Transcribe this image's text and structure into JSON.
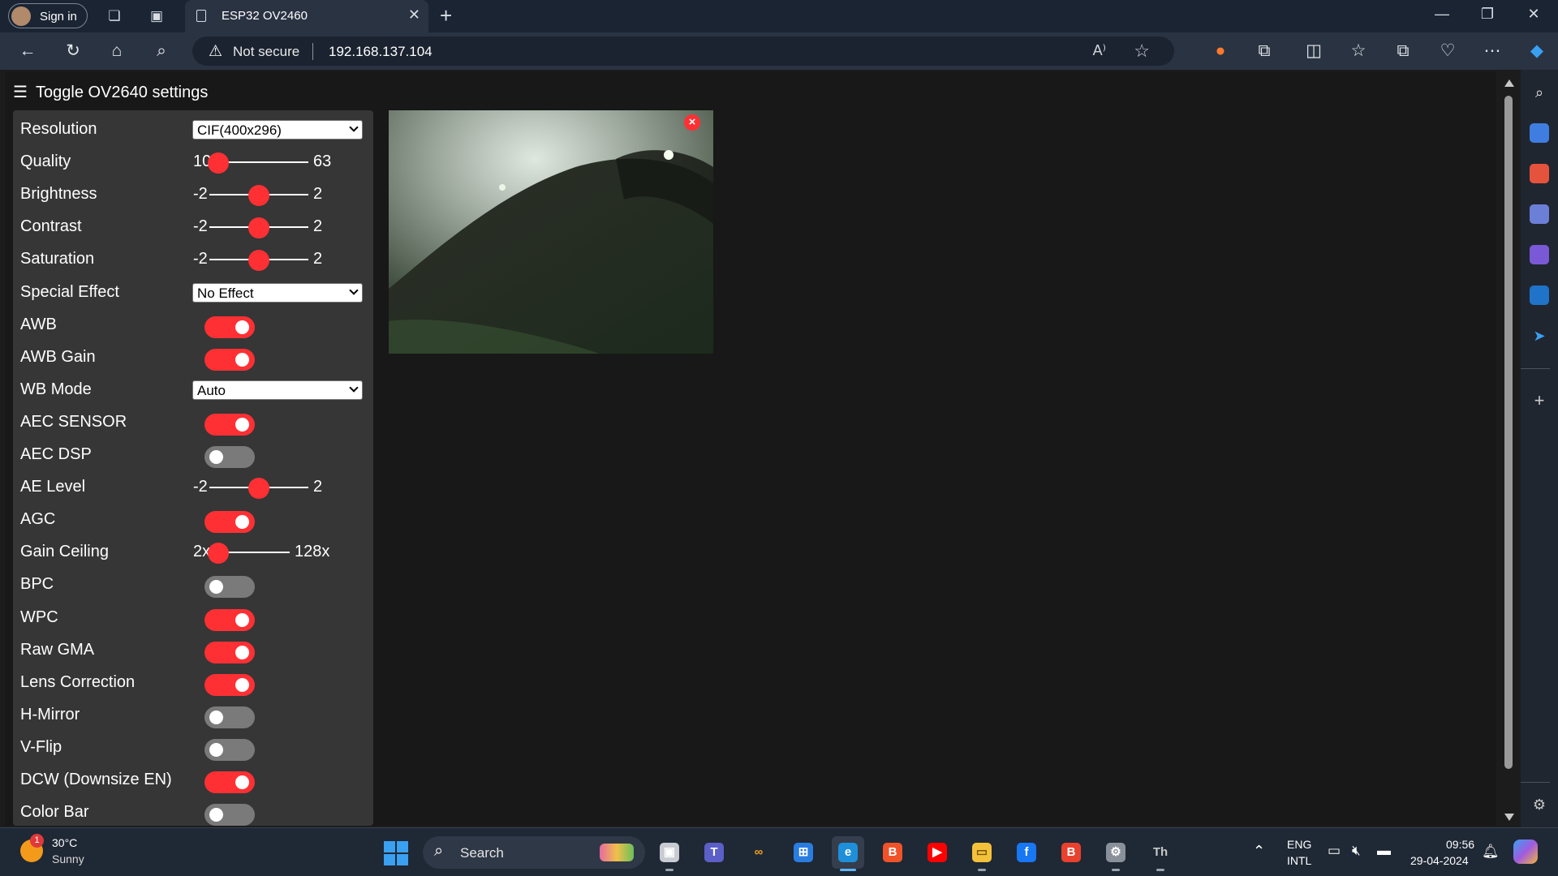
{
  "browser": {
    "signin_label": "Sign in",
    "tab_title": "ESP32 OV2460",
    "security_label": "Not secure",
    "url": "192.168.137.104"
  },
  "page": {
    "toggle_label": "Toggle OV2640 settings",
    "accent_color": "#ff3034",
    "settings": [
      {
        "key": "resolution",
        "label": "Resolution",
        "type": "select",
        "value": "CIF(400x296)"
      },
      {
        "key": "quality",
        "label": "Quality",
        "type": "range",
        "min": "10",
        "max": "63",
        "value_fraction": 0.0
      },
      {
        "key": "brightness",
        "label": "Brightness",
        "type": "range",
        "min": "-2",
        "max": "2",
        "value_fraction": 0.5
      },
      {
        "key": "contrast",
        "label": "Contrast",
        "type": "range",
        "min": "-2",
        "max": "2",
        "value_fraction": 0.5
      },
      {
        "key": "saturation",
        "label": "Saturation",
        "type": "range",
        "min": "-2",
        "max": "2",
        "value_fraction": 0.5
      },
      {
        "key": "special_effect",
        "label": "Special Effect",
        "type": "select",
        "value": "No Effect"
      },
      {
        "key": "awb",
        "label": "AWB",
        "type": "toggle",
        "on": true
      },
      {
        "key": "awb_gain",
        "label": "AWB Gain",
        "type": "toggle",
        "on": true
      },
      {
        "key": "wb_mode",
        "label": "WB Mode",
        "type": "select",
        "value": "Auto"
      },
      {
        "key": "aec_sensor",
        "label": "AEC SENSOR",
        "type": "toggle",
        "on": true
      },
      {
        "key": "aec_dsp",
        "label": "AEC DSP",
        "type": "toggle",
        "on": false
      },
      {
        "key": "ae_level",
        "label": "AE Level",
        "type": "range",
        "min": "-2",
        "max": "2",
        "value_fraction": 0.5
      },
      {
        "key": "agc",
        "label": "AGC",
        "type": "toggle",
        "on": true
      },
      {
        "key": "gain_ceiling",
        "label": "Gain Ceiling",
        "type": "range",
        "min": "2x",
        "max": "128x",
        "value_fraction": 0.0
      },
      {
        "key": "bpc",
        "label": "BPC",
        "type": "toggle",
        "on": false
      },
      {
        "key": "wpc",
        "label": "WPC",
        "type": "toggle",
        "on": true
      },
      {
        "key": "raw_gma",
        "label": "Raw GMA",
        "type": "toggle",
        "on": true
      },
      {
        "key": "lens_correction",
        "label": "Lens Correction",
        "type": "toggle",
        "on": true
      },
      {
        "key": "h_mirror",
        "label": "H-Mirror",
        "type": "toggle",
        "on": false
      },
      {
        "key": "v_flip",
        "label": "V-Flip",
        "type": "toggle",
        "on": false
      },
      {
        "key": "dcw",
        "label": "DCW (Downsize EN)",
        "type": "toggle",
        "on": true
      },
      {
        "key": "color_bar",
        "label": "Color Bar",
        "type": "toggle",
        "on": false
      }
    ],
    "stream_close_label": "×"
  },
  "taskbar": {
    "weather_temp": "30°C",
    "weather_cond": "Sunny",
    "weather_badge": "1",
    "search_label": "Search",
    "lang_line1": "ENG",
    "lang_line2": "INTL",
    "time": "09:56",
    "date": "29-04-2024",
    "pinned_apps": [
      "file-explorer-task-view",
      "teams",
      "infinity-app",
      "microsoft-store",
      "edge",
      "brave",
      "youtube",
      "file-explorer",
      "facebook",
      "brave-beta",
      "settings",
      "text-app"
    ]
  }
}
